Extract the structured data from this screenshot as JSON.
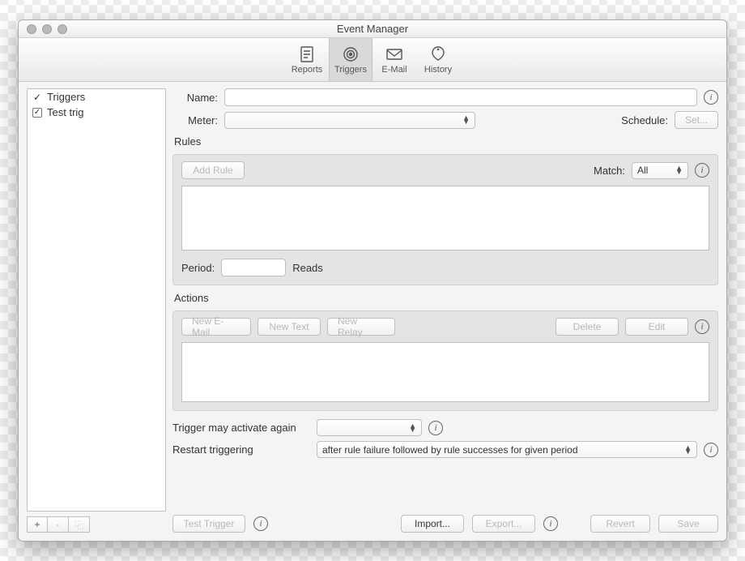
{
  "window": {
    "title": "Event Manager"
  },
  "toolbar": {
    "items": [
      {
        "label": "Reports"
      },
      {
        "label": "Triggers"
      },
      {
        "label": "E-Mail"
      },
      {
        "label": "History"
      }
    ]
  },
  "sidebar": {
    "items": [
      {
        "label": "Triggers",
        "checked": true,
        "style": "check"
      },
      {
        "label": "Test trig",
        "checked": true,
        "style": "box"
      }
    ],
    "buttons": {
      "add": "+",
      "remove": "-",
      "dup": "⿻"
    }
  },
  "form": {
    "name_label": "Name:",
    "name_value": "",
    "meter_label": "Meter:",
    "meter_value": "",
    "schedule_label": "Schedule:",
    "schedule_button": "Set..."
  },
  "rules": {
    "title": "Rules",
    "add_button": "Add Rule",
    "match_label": "Match:",
    "match_value": "All",
    "period_label": "Period:",
    "period_value": "",
    "period_suffix": "Reads"
  },
  "actions": {
    "title": "Actions",
    "new_email": "New E-Mail",
    "new_text": "New Text",
    "new_relay": "New Relay",
    "delete": "Delete",
    "edit": "Edit"
  },
  "reactivate": {
    "label": "Trigger may activate again",
    "value": ""
  },
  "restart": {
    "label": "Restart triggering",
    "value": "after rule failure followed by rule successes for given period"
  },
  "footer": {
    "test": "Test Trigger",
    "import": "Import...",
    "export": "Export...",
    "revert": "Revert",
    "save": "Save"
  }
}
